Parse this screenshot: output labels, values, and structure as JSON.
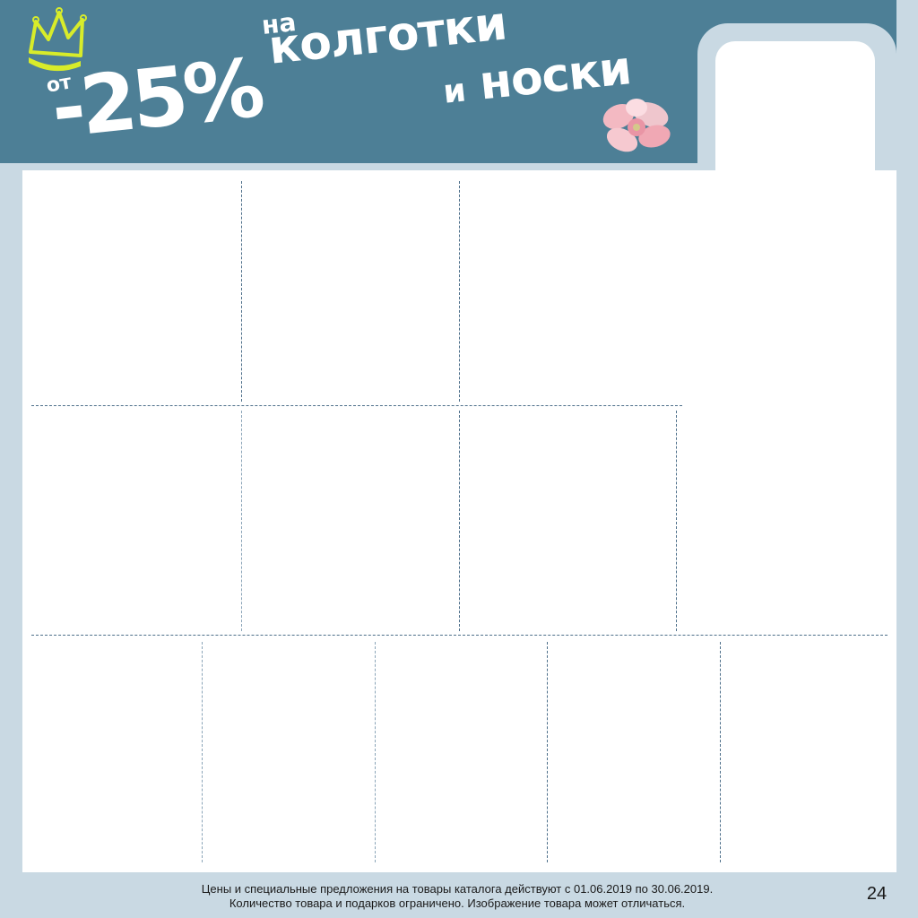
{
  "header": {
    "prefix": "от",
    "discount": "-25%",
    "preposition": "на",
    "product_line1": "колготки",
    "conjunction": "и",
    "product_line2": "носки",
    "colors": {
      "banner": "#4d7f96",
      "frame": "#c9d9e3",
      "text": "#ffffff",
      "crown": "#d8ec2a",
      "flower": "#f3b9c2"
    },
    "icons": [
      "crown-icon",
      "flower-icon"
    ]
  },
  "footer": {
    "line1": "Цены и специальные предложения на товары каталога действуют с 01.06.2019 по 30.06.2019.",
    "line2": "Количество товара и подарков ограничено. Изображение товара может отличаться."
  },
  "page_number": "24"
}
